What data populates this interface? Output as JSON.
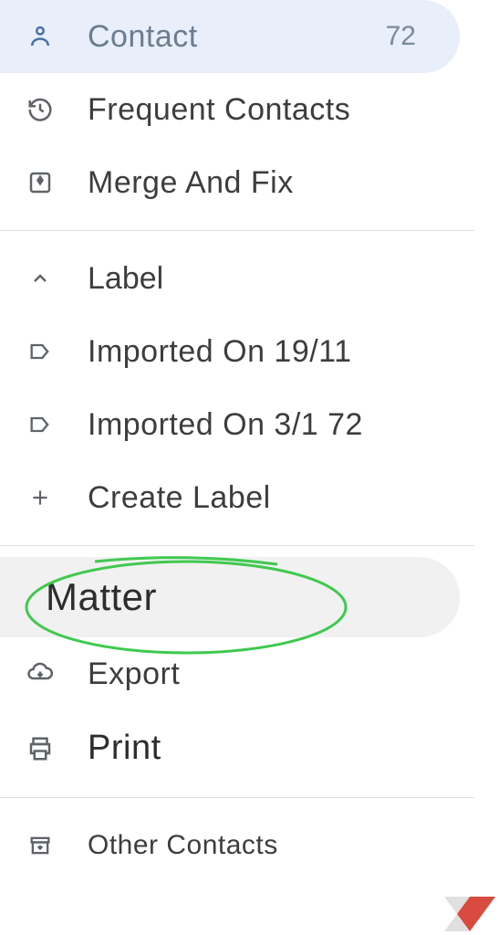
{
  "nav": {
    "contact": {
      "label": "Contact",
      "count": "72"
    },
    "frequent": {
      "label": "Frequent Contacts"
    },
    "merge": {
      "label": "Merge And Fix"
    }
  },
  "labels": {
    "header": "Label",
    "items": [
      {
        "label": "Imported On 19/11"
      },
      {
        "label": "Imported On 3/1 72"
      }
    ],
    "create": "Create Label"
  },
  "actions": {
    "import": {
      "label": "Matter"
    },
    "export": {
      "label": "Export"
    },
    "print": {
      "label": "Print"
    }
  },
  "other": {
    "label": "Other Contacts"
  }
}
